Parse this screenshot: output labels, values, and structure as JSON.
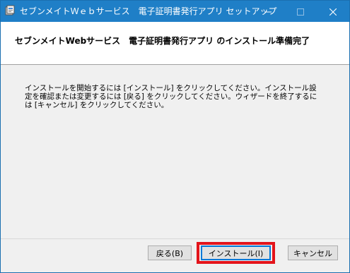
{
  "window": {
    "title": "セブンメイトＷｅｂサービス　電子証明書発行アプリ セットアップ"
  },
  "header": {
    "title": "セブンメイトWebサービス　電子証明書発行アプリ のインストール準備完了"
  },
  "body": {
    "text": "インストールを開始するには [インストール] をクリックしてください。インストール設定を確認または変更するには [戻る] をクリックしてください。ウィザードを終了するには [キャンセル] をクリックしてください。"
  },
  "buttons": {
    "back_label": "戻る(B)",
    "install_label": "インストール(I)",
    "cancel_label": "キャンセル"
  },
  "colors": {
    "titlebar": "#1f7fc7",
    "highlight": "#e3141b",
    "default_button_border": "#0078d7"
  },
  "icons": {
    "app": "installer-app-icon",
    "minimize": "minimize-icon",
    "maximize": "maximize-icon",
    "close": "close-icon"
  }
}
